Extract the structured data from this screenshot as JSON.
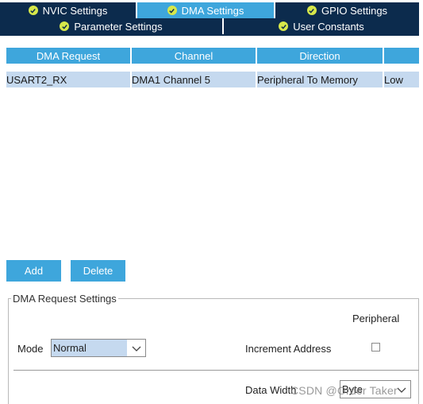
{
  "tabs_row1": [
    {
      "label": "NVIC Settings",
      "active": false
    },
    {
      "label": "DMA Settings",
      "active": true
    },
    {
      "label": "GPIO Settings",
      "active": false
    }
  ],
  "tabs_row2": [
    {
      "label": "Parameter Settings"
    },
    {
      "label": "User Constants"
    }
  ],
  "table": {
    "headers": [
      "DMA Request",
      "Channel",
      "Direction",
      ""
    ],
    "rows": [
      [
        "USART2_RX",
        "DMA1 Channel 5",
        "Peripheral To Memory",
        "Low"
      ]
    ]
  },
  "buttons": {
    "add": "Add",
    "delete": "Delete"
  },
  "settings": {
    "legend": "DMA Request Settings",
    "peripheral_header": "Peripheral",
    "mode_label": "Mode",
    "mode_value": "Normal",
    "increment_label": "Increment Address",
    "data_width_label": "Data Width",
    "data_width_value": "Byte"
  },
  "watermark": "CSDN @Order Taker",
  "colors": {
    "tab_dark": "#0c2b4d",
    "tab_active": "#3ea6dc",
    "check_icon": "#d7e84a",
    "selected_row": "#c5d9ef"
  }
}
